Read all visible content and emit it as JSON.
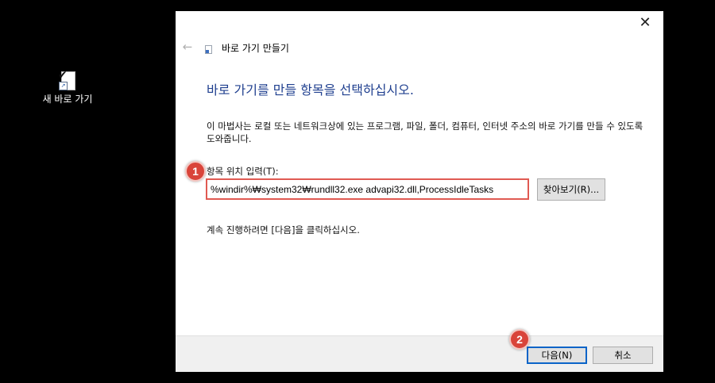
{
  "desktop": {
    "icon_label": "새 바로 가기",
    "icon_name": "new-shortcut-icon"
  },
  "wizard": {
    "title": "바로 가기 만들기",
    "back_icon": "back-arrow-icon",
    "close_glyph": "✕",
    "heading": "바로 가기를 만들 항목을 선택하십시오.",
    "description": "이 마법사는 로컬 또는 네트워크상에 있는 프로그램, 파일, 폴더, 컴퓨터, 인터넷 주소의 바로 가기를 만들 수 있도록 도와줍니다.",
    "field_label": "항목 위치 입력(T):",
    "location_value": "%windir%₩system32₩rundll32.exe advapi32.dll,ProcessIdleTasks",
    "browse_label": "찾아보기(R)...",
    "continue_text": "계속 진행하려면 [다음]을 클릭하십시오.",
    "next_label": "다음(N)",
    "cancel_label": "취소"
  },
  "annotations": {
    "badge_1": "1",
    "badge_2": "2",
    "color": "#d9443a"
  },
  "colors": {
    "heading": "#1f3f8f",
    "highlight_border": "#e05a52",
    "default_button_border": "#0a64c8"
  }
}
